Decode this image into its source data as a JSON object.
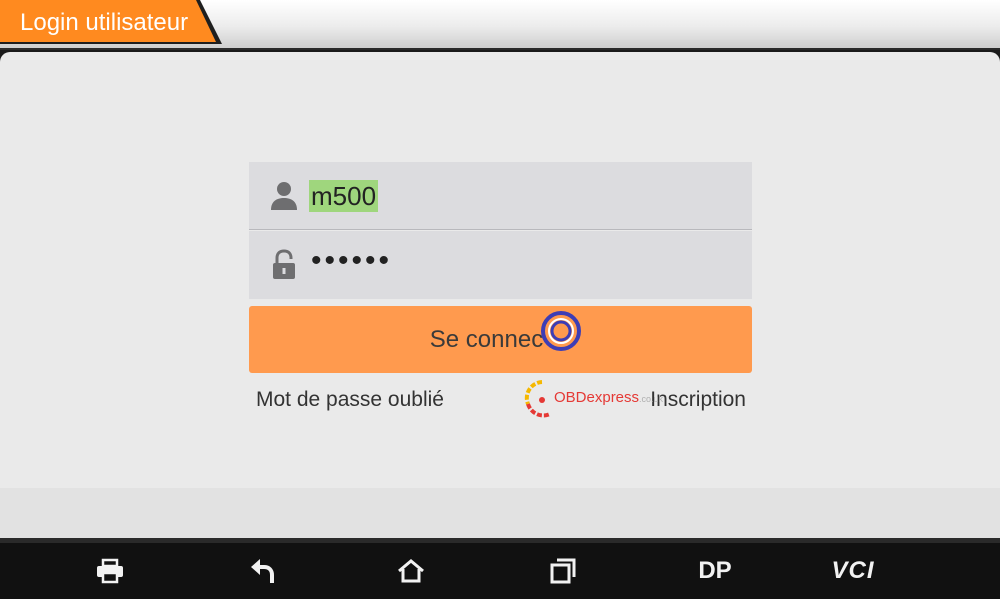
{
  "header": {
    "title": "Login utilisateur",
    "accent_color": "#ff8a1f"
  },
  "login_form": {
    "username": {
      "value": "m500",
      "icon": "user-icon",
      "highlight_color": "#9fd67d"
    },
    "password": {
      "masked_value": "••••••",
      "icon": "lock-icon"
    },
    "login_button_label": "Se connecter",
    "login_button_visible_label": "Se connec",
    "login_button_color": "#ff9a4e",
    "forgot_password_label": "Mot de passe oublié",
    "register_label": "Inscription"
  },
  "watermark": {
    "text": "OBDexpress",
    "tld": ".co.uk",
    "color": "#e53935"
  },
  "navbar": {
    "items": [
      {
        "icon": "print-icon"
      },
      {
        "icon": "back-icon"
      },
      {
        "icon": "home-icon"
      },
      {
        "icon": "recent-apps-icon"
      },
      {
        "label": "DP"
      },
      {
        "label": "VCI"
      }
    ]
  }
}
